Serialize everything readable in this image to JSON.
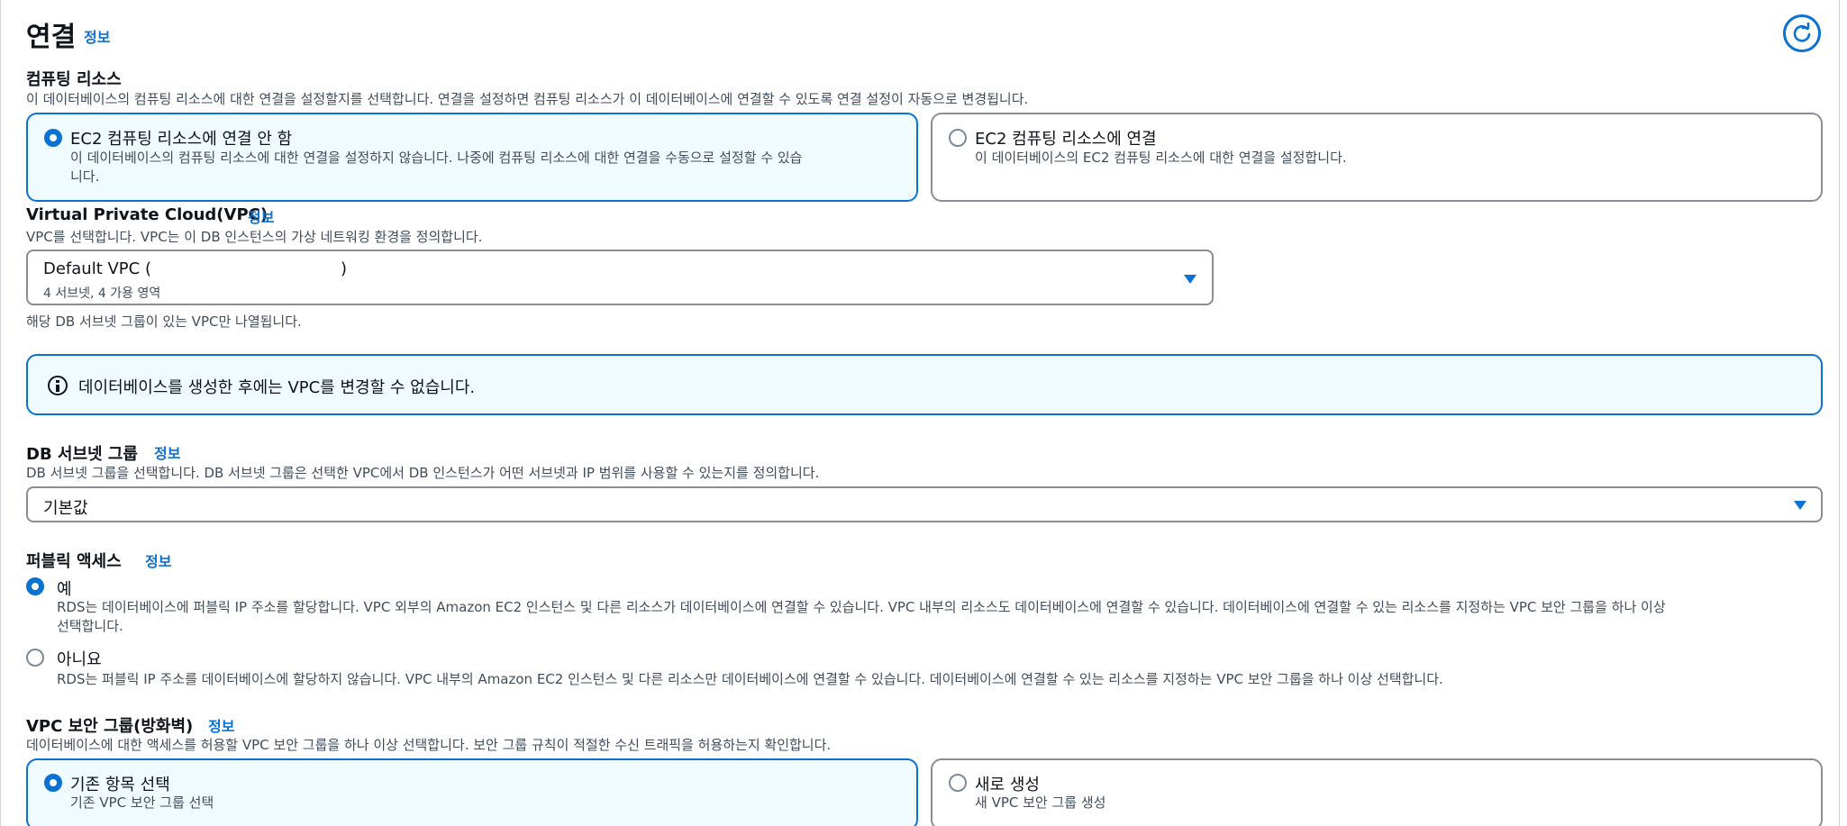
{
  "section": {
    "title": "연결",
    "info": "정보"
  },
  "compute": {
    "label": "컴퓨팅 리소스",
    "desc": "이 데이터베이스의 컴퓨팅 리소스에 대한 연결을 설정할지를 선택합니다. 연결을 설정하면 컴퓨팅 리소스가 이 데이터베이스에 연결할 수 있도록 연결 설정이 자동으로 변경됩니다.",
    "options": [
      {
        "title": "EC2 컴퓨팅 리소스에 연결 안 함",
        "desc_line1": "이 데이터베이스의 컴퓨팅 리소스에 대한 연결을 설정하지 않습니다. 나중에 컴퓨팅 리소스에 대한 연결을 수동으로 설정할 수 있습",
        "desc_line2": "니다.",
        "selected": true
      },
      {
        "title": "EC2 컴퓨팅 리소스에 연결",
        "desc_line1": "이 데이터베이스의 EC2 컴퓨팅 리소스에 대한 연결을 설정합니다.",
        "desc_line2": "",
        "selected": false
      }
    ]
  },
  "vpc": {
    "label": "Virtual Private Cloud(VPC)",
    "info": "정보",
    "desc": "VPC를 선택합니다. VPC는 이 DB 인스턴스의 가상 네트워킹 환경을 정의합니다.",
    "selected_name": "Default VPC (",
    "selected_suffix": ")",
    "selected_sub": "4 서브넷, 4 가용 영역",
    "hint": "해당 DB 서브넷 그룹이 있는 VPC만 나열됩니다."
  },
  "alert": {
    "text": "데이터베이스를 생성한 후에는 VPC를 변경할 수 없습니다."
  },
  "subnet": {
    "label": "DB 서브넷 그룹",
    "info": "정보",
    "desc": "DB 서브넷 그룹을 선택합니다. DB 서브넷 그룹은 선택한 VPC에서 DB 인스턴스가 어떤 서브넷과 IP 범위를 사용할 수 있는지를 정의합니다.",
    "value": "기본값"
  },
  "public": {
    "label": "퍼블릭 액세스",
    "info": "정보",
    "options": [
      {
        "title": "예",
        "desc_line1": "RDS는 데이터베이스에 퍼블릭 IP 주소를 할당합니다. VPC 외부의 Amazon EC2 인스턴스 및 다른 리소스가 데이터베이스에 연결할 수 있습니다. VPC 내부의 리소스도 데이터베이스에 연결할 수 있습니다. 데이터베이스에 연결할 수 있는 리소스를 지정하는 VPC 보안 그룹을 하나 이상",
        "desc_line2": "선택합니다.",
        "selected": true
      },
      {
        "title": "아니요",
        "desc_line1": "RDS는 퍼블릭 IP 주소를 데이터베이스에 할당하지 않습니다. VPC 내부의 Amazon EC2 인스턴스 및 다른 리소스만 데이터베이스에 연결할 수 있습니다. 데이터베이스에 연결할 수 있는 리소스를 지정하는 VPC 보안 그룹을 하나 이상 선택합니다.",
        "desc_line2": "",
        "selected": false
      }
    ]
  },
  "sg": {
    "label": "VPC 보안 그룹(방화벽)",
    "info": "정보",
    "desc": "데이터베이스에 대한 액세스를 허용할 VPC 보안 그룹을 하나 이상 선택합니다. 보안 그룹 규칙이 적절한 수신 트래픽을 허용하는지 확인합니다.",
    "options": [
      {
        "title": "기존 항목 선택",
        "desc": "기존 VPC 보안 그룹 선택",
        "selected": true
      },
      {
        "title": "새로 생성",
        "desc": "새 VPC 보안 그룹 생성",
        "selected": false
      }
    ]
  },
  "colors": {
    "accent": "#0972d3",
    "selected_bg": "#f0fbff",
    "border": "#8c8c94"
  },
  "icons": {
    "refresh": "refresh-icon",
    "info": "info-circle-icon",
    "caret": "caret-down-icon"
  }
}
